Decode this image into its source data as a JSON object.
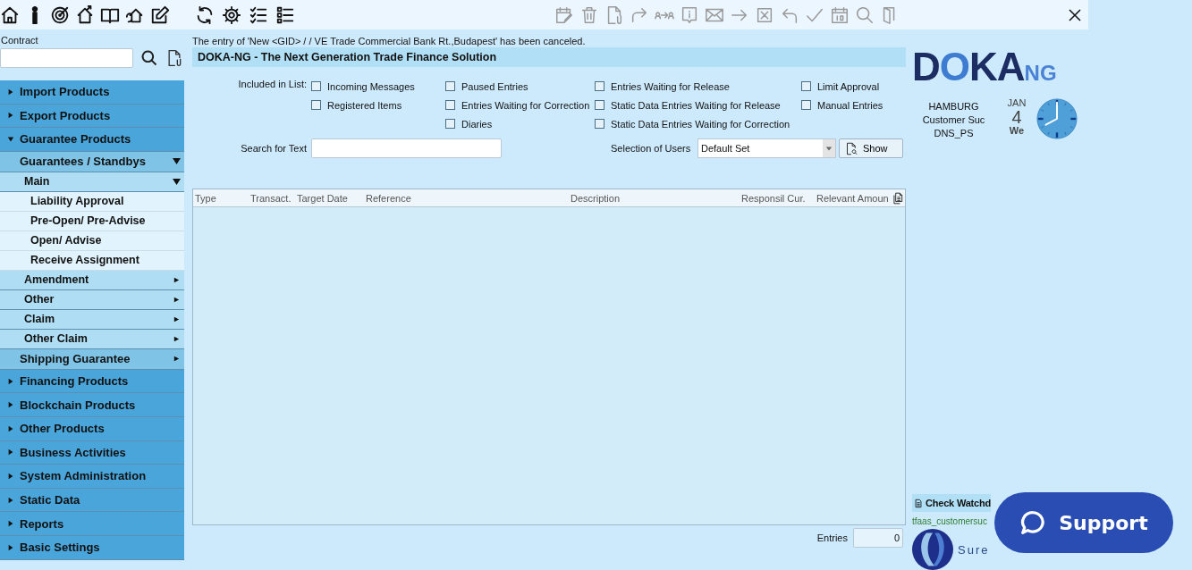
{
  "message": "The entry of 'New <GID> / / VE Trade Commercial Bank Rt.,Budapest' has been canceled.",
  "title": "DOKA-NG - The Next Generation Trade Finance Solution",
  "sidebar": {
    "contract_label": "Contract",
    "items": [
      {
        "label": "Import Products",
        "expanded": false
      },
      {
        "label": "Export Products",
        "expanded": false
      },
      {
        "label": "Guarantee Products",
        "expanded": true,
        "children": [
          {
            "label": "Guarantees / Standbys",
            "expanded": true,
            "children": [
              {
                "label": "Main",
                "expanded": true,
                "children": [
                  {
                    "label": "Liability Approval"
                  },
                  {
                    "label": "Pre-Open/ Pre-Advise"
                  },
                  {
                    "label": "Open/ Advise"
                  },
                  {
                    "label": "Receive Assignment"
                  }
                ]
              },
              {
                "label": "Amendment",
                "expanded": false
              },
              {
                "label": "Other",
                "expanded": false
              },
              {
                "label": "Claim",
                "expanded": false
              },
              {
                "label": "Other Claim",
                "expanded": false
              }
            ]
          },
          {
            "label": "Shipping Guarantee",
            "expanded": false
          }
        ]
      },
      {
        "label": "Financing Products",
        "expanded": false
      },
      {
        "label": "Blockchain Products",
        "expanded": false
      },
      {
        "label": "Other Products",
        "expanded": false
      },
      {
        "label": "Business Activities",
        "expanded": false
      },
      {
        "label": "System Administration",
        "expanded": false
      },
      {
        "label": "Static Data",
        "expanded": false
      },
      {
        "label": "Reports",
        "expanded": false
      },
      {
        "label": "Basic Settings",
        "expanded": false
      }
    ]
  },
  "filters": {
    "included_label": "Included in List:",
    "columns": [
      [
        {
          "label": "Incoming Messages",
          "checked": false
        },
        {
          "label": "Registered Items",
          "checked": false
        }
      ],
      [
        {
          "label": "Paused Entries",
          "checked": false
        },
        {
          "label": "Entries Waiting for Correction",
          "checked": false
        },
        {
          "label": "Diaries",
          "checked": false
        }
      ],
      [
        {
          "label": "Entries Waiting for Release",
          "checked": false
        },
        {
          "label": "Static Data Entries Waiting for Release",
          "checked": false
        },
        {
          "label": "Static Data Entries Waiting for Correction",
          "checked": false
        }
      ],
      [
        {
          "label": "Limit Approval",
          "checked": false
        },
        {
          "label": "Manual Entries",
          "checked": false
        }
      ]
    ],
    "search_label": "Search for Text",
    "users_label": "Selection of Users",
    "users_value": "Default Set",
    "show_button": "Show"
  },
  "table": {
    "columns": [
      "Type",
      "Transact.",
      "Target Date",
      "Reference",
      "Description",
      "Responsil Cur.",
      "Relevant Amoun"
    ]
  },
  "entries": {
    "label": "Entries",
    "value": "0"
  },
  "info": {
    "logo": "DOKA",
    "logo_suffix": "NG",
    "lines": [
      "HAMBURG",
      "Customer Suc",
      "DNS_PS"
    ],
    "month": "JAN",
    "day": "4",
    "weekday": "We"
  },
  "watchdog": {
    "title": "Check Watchd",
    "user": "tfaas_customersuc",
    "brand": "Sure"
  },
  "support_button": "Support"
}
